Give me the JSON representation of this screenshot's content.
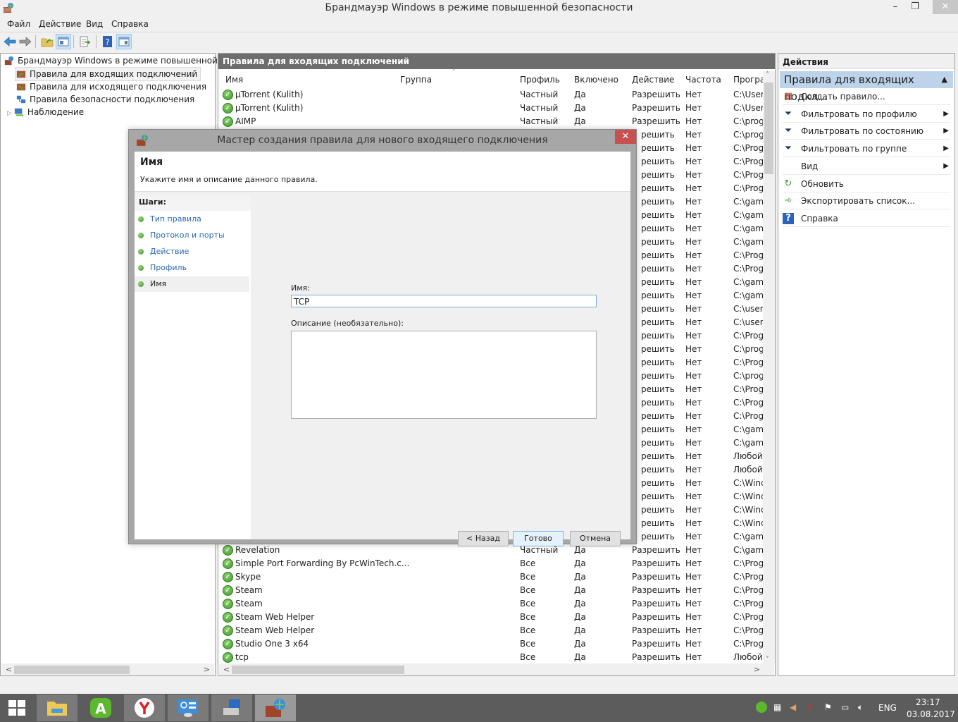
{
  "window": {
    "title": "Брандмауэр Windows в режиме повышенной безопасности",
    "minimize_glyph": "–",
    "restore_glyph": "❐",
    "close_glyph": "✕"
  },
  "menu": [
    "Файл",
    "Действие",
    "Вид",
    "Справка"
  ],
  "toolbar": {
    "icons": [
      "back-icon",
      "forward-icon",
      "up-folder-icon",
      "show-tree-icon",
      "export-icon",
      "help-icon",
      "show-actions-icon"
    ]
  },
  "tree": {
    "root": "Брандмауэр Windows в режиме повышенной безопасности",
    "items": [
      {
        "label": "Правила для входящих подключений",
        "selected": true
      },
      {
        "label": "Правила для исходящего подключения",
        "selected": false
      },
      {
        "label": "Правила безопасности подключения",
        "selected": false
      },
      {
        "label": "Наблюдение",
        "selected": false,
        "expander": "▷"
      }
    ]
  },
  "center": {
    "header": "Правила для входящих подключений",
    "sort_indicator": "˄",
    "columns": [
      "Имя",
      "Группа",
      "Профиль",
      "Включено",
      "Действие",
      "Частота",
      "Програ"
    ],
    "rows_top": [
      {
        "name": "µTorrent (Kulith)",
        "group": "",
        "profile": "Частный",
        "enabled": "Да",
        "action": "Разрешить",
        "override": "Нет",
        "program": "C:\\Users"
      },
      {
        "name": "µTorrent (Kulith)",
        "group": "",
        "profile": "Частный",
        "enabled": "Да",
        "action": "Разрешить",
        "override": "Нет",
        "program": "C:\\Users"
      },
      {
        "name": "AIMP",
        "group": "",
        "profile": "Частный",
        "enabled": "Да",
        "action": "Разрешить",
        "override": "Нет",
        "program": "C:\\prog"
      }
    ],
    "rows_hidden_partial": [
      {
        "action": "решить",
        "override": "Нет",
        "program": "C:\\prog"
      },
      {
        "action": "решить",
        "override": "Нет",
        "program": "C:\\Prog"
      },
      {
        "action": "решить",
        "override": "Нет",
        "program": "C:\\Prog"
      },
      {
        "action": "решить",
        "override": "Нет",
        "program": "C:\\Prog"
      },
      {
        "action": "решить",
        "override": "Нет",
        "program": "C:\\Prog"
      },
      {
        "action": "решить",
        "override": "Нет",
        "program": "C:\\gam"
      },
      {
        "action": "решить",
        "override": "Нет",
        "program": "C:\\gam"
      },
      {
        "action": "решить",
        "override": "Нет",
        "program": "C:\\gam"
      },
      {
        "action": "решить",
        "override": "Нет",
        "program": "C:\\gam"
      },
      {
        "action": "решить",
        "override": "Нет",
        "program": "C:\\Prog"
      },
      {
        "action": "решить",
        "override": "Нет",
        "program": "C:\\Prog"
      },
      {
        "action": "решить",
        "override": "Нет",
        "program": "C:\\gam"
      },
      {
        "action": "решить",
        "override": "Нет",
        "program": "C:\\gam"
      },
      {
        "action": "решить",
        "override": "Нет",
        "program": "C:\\users"
      },
      {
        "action": "решить",
        "override": "Нет",
        "program": "C:\\users"
      },
      {
        "action": "решить",
        "override": "Нет",
        "program": "C:\\Prog"
      },
      {
        "action": "решить",
        "override": "Нет",
        "program": "C:\\prog"
      },
      {
        "action": "решить",
        "override": "Нет",
        "program": "C:\\Prog"
      },
      {
        "action": "решить",
        "override": "Нет",
        "program": "C:\\prog"
      },
      {
        "action": "решить",
        "override": "Нет",
        "program": "C:\\Prog"
      },
      {
        "action": "решить",
        "override": "Нет",
        "program": "C:\\Prog"
      },
      {
        "action": "решить",
        "override": "Нет",
        "program": "C:\\Prog"
      },
      {
        "action": "решить",
        "override": "Нет",
        "program": "C:\\gam"
      },
      {
        "action": "решить",
        "override": "Нет",
        "program": "C:\\gam"
      },
      {
        "action": "решить",
        "override": "Нет",
        "program": "Любой"
      },
      {
        "action": "решить",
        "override": "Нет",
        "program": "Любой"
      },
      {
        "action": "решить",
        "override": "Нет",
        "program": "C:\\Winc"
      },
      {
        "action": "решить",
        "override": "Нет",
        "program": "C:\\Winc"
      },
      {
        "action": "решить",
        "override": "Нет",
        "program": "C:\\Winc"
      },
      {
        "action": "решить",
        "override": "Нет",
        "program": "C:\\Winc"
      },
      {
        "action": "решить",
        "override": "Нет",
        "program": "C:\\gam"
      }
    ],
    "rows_bottom": [
      {
        "name": "Revelation",
        "group": "",
        "profile": "Частный",
        "enabled": "Да",
        "action": "Разрешить",
        "override": "Нет",
        "program": "C:\\gam"
      },
      {
        "name": "Simple Port Forwarding By PcWinTech.c...",
        "group": "",
        "profile": "Все",
        "enabled": "Да",
        "action": "Разрешить",
        "override": "Нет",
        "program": "C:\\Prog"
      },
      {
        "name": "Skype",
        "group": "",
        "profile": "Все",
        "enabled": "Да",
        "action": "Разрешить",
        "override": "Нет",
        "program": "C:\\Prog"
      },
      {
        "name": "Steam",
        "group": "",
        "profile": "Все",
        "enabled": "Да",
        "action": "Разрешить",
        "override": "Нет",
        "program": "C:\\Prog"
      },
      {
        "name": "Steam",
        "group": "",
        "profile": "Все",
        "enabled": "Да",
        "action": "Разрешить",
        "override": "Нет",
        "program": "C:\\Prog"
      },
      {
        "name": "Steam Web Helper",
        "group": "",
        "profile": "Все",
        "enabled": "Да",
        "action": "Разрешить",
        "override": "Нет",
        "program": "C:\\Prog"
      },
      {
        "name": "Steam Web Helper",
        "group": "",
        "profile": "Все",
        "enabled": "Да",
        "action": "Разрешить",
        "override": "Нет",
        "program": "C:\\Prog"
      },
      {
        "name": "Studio One 3 x64",
        "group": "",
        "profile": "Все",
        "enabled": "Да",
        "action": "Разрешить",
        "override": "Нет",
        "program": "C:\\Prog"
      },
      {
        "name": "tcp",
        "group": "",
        "profile": "Все",
        "enabled": "Да",
        "action": "Разрешить",
        "override": "Нет",
        "program": "Любой"
      }
    ]
  },
  "actions": {
    "header": "Действия",
    "subheader": "Правила для входящих подкл...",
    "items": [
      {
        "label": "Создать правило...",
        "icon": "new-rule-icon",
        "submenu": false
      },
      {
        "label": "Фильтровать по профилю",
        "icon": "filter-icon",
        "submenu": true
      },
      {
        "label": "Фильтровать по состоянию",
        "icon": "filter-icon",
        "submenu": true
      },
      {
        "label": "Фильтровать по группе",
        "icon": "filter-icon",
        "submenu": true
      },
      {
        "label": "Вид",
        "icon": "",
        "submenu": true
      },
      {
        "label": "Обновить",
        "icon": "refresh-icon",
        "submenu": false
      },
      {
        "label": "Экспортировать список...",
        "icon": "export-list-icon",
        "submenu": false
      },
      {
        "label": "Справка",
        "icon": "help-icon",
        "submenu": false
      }
    ]
  },
  "dialog": {
    "title": "Мастер создания правила для нового входящего подключения",
    "heading": "Имя",
    "subtitle": "Укажите имя и описание данного правила.",
    "steps_title": "Шаги:",
    "steps": [
      {
        "label": "Тип правила",
        "current": false
      },
      {
        "label": "Протокол и порты",
        "current": false
      },
      {
        "label": "Действие",
        "current": false
      },
      {
        "label": "Профиль",
        "current": false
      },
      {
        "label": "Имя",
        "current": true
      }
    ],
    "name_label": "Имя:",
    "name_value": "TCP",
    "description_label": "Описание (необязательно):",
    "description_value": "",
    "buttons": {
      "back": "< Назад",
      "finish": "Готово",
      "cancel": "Отмена"
    }
  },
  "taskbar": {
    "apps": [
      "start",
      "file-explorer",
      "app-a",
      "yandex-browser",
      "control-panel",
      "network-app",
      "firewall"
    ],
    "tray": {
      "language": "ENG",
      "time": "23:17",
      "date": "03.08.2017"
    }
  }
}
